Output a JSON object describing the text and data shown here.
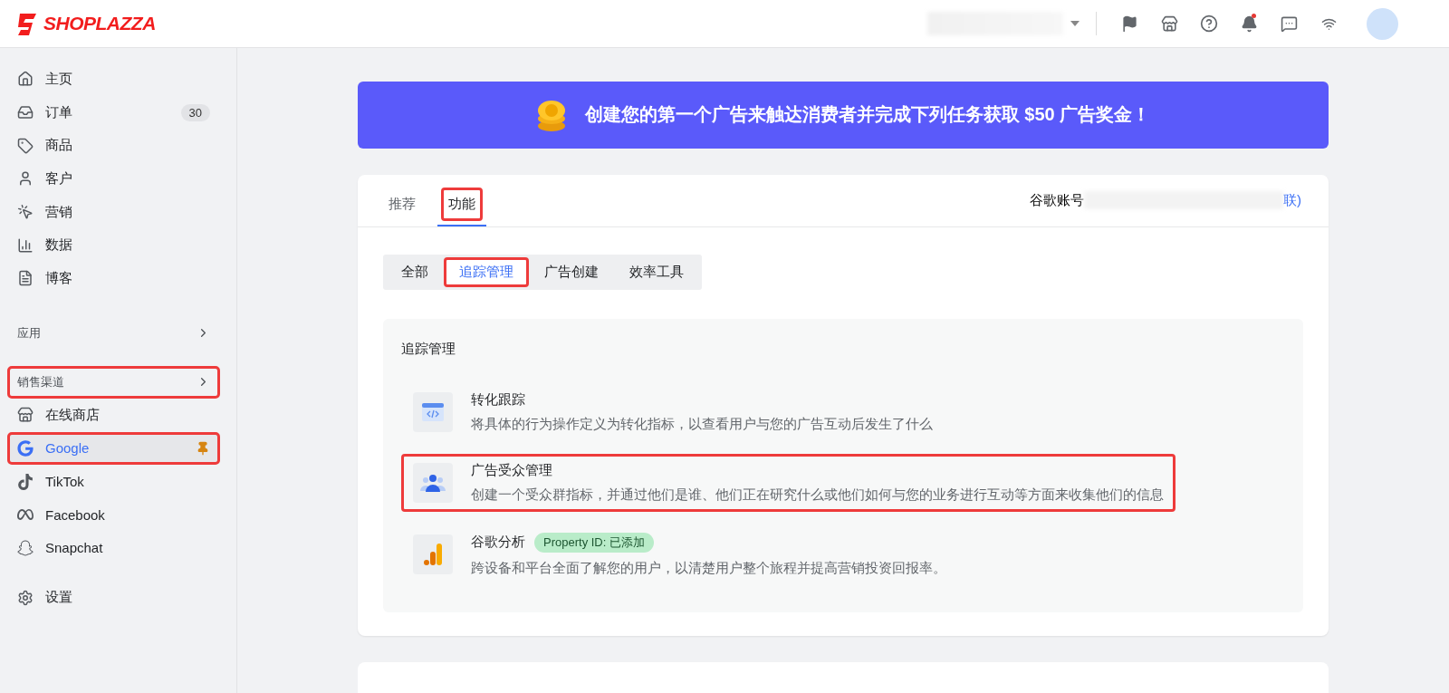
{
  "header": {
    "logo": "SHOPLAZZA",
    "bell_unread": true
  },
  "sidebar": {
    "main_items": [
      {
        "label": "主页",
        "selected": false
      },
      {
        "label": "订单",
        "selected": false,
        "badge": "30"
      },
      {
        "label": "商品",
        "selected": false
      },
      {
        "label": "客户",
        "selected": false
      },
      {
        "label": "营销",
        "selected": false
      },
      {
        "label": "数据",
        "selected": false
      },
      {
        "label": "博客",
        "selected": false
      }
    ],
    "sections": [
      {
        "title": "应用",
        "highlighted": false
      },
      {
        "title": "销售渠道",
        "highlighted": true
      }
    ],
    "channels": [
      {
        "label": "在线商店",
        "selected": false,
        "highlighted": false,
        "pinned": false
      },
      {
        "label": "Google",
        "selected": true,
        "highlighted": true,
        "pinned": true
      },
      {
        "label": "TikTok",
        "selected": false,
        "highlighted": false,
        "pinned": false
      },
      {
        "label": "Facebook",
        "selected": false,
        "highlighted": false,
        "pinned": false
      },
      {
        "label": "Snapchat",
        "selected": false,
        "highlighted": false,
        "pinned": false
      }
    ],
    "settings": {
      "label": "设置"
    }
  },
  "banner": {
    "text": "创建您的第一个广告来触达消费者并完成下列任务获取 $50 广告奖金！"
  },
  "tabs": [
    {
      "label": "推荐",
      "selected": false,
      "highlighted": false
    },
    {
      "label": "功能",
      "selected": true,
      "highlighted": true
    }
  ],
  "account": {
    "label": "谷歌账号",
    "link": "联)"
  },
  "subtabs": [
    {
      "label": "全部",
      "selected": false,
      "highlighted": false
    },
    {
      "label": "追踪管理",
      "selected": true,
      "highlighted": true
    },
    {
      "label": "广告创建",
      "selected": false,
      "highlighted": false
    },
    {
      "label": "效率工具",
      "selected": false,
      "highlighted": false
    }
  ],
  "section": {
    "title": "追踪管理",
    "features": [
      {
        "kind": "conversion",
        "title": "转化跟踪",
        "description": "将具体的行为操作定义为转化指标，以查看用户与您的广告互动后发生了什么",
        "highlighted": false
      },
      {
        "kind": "audience",
        "title": "广告受众管理",
        "description": "创建一个受众群指标，并通过他们是谁、他们正在研究什么或他们如何与您的业务进行互动等方面来收集他们的信息",
        "highlighted": true
      },
      {
        "kind": "analytics",
        "title": "谷歌分析",
        "tag": "Property ID: 已添加",
        "description": "跨设备和平台全面了解您的用户，以清楚用户整个旅程并提高营销投资回报率。",
        "highlighted": false
      }
    ]
  }
}
